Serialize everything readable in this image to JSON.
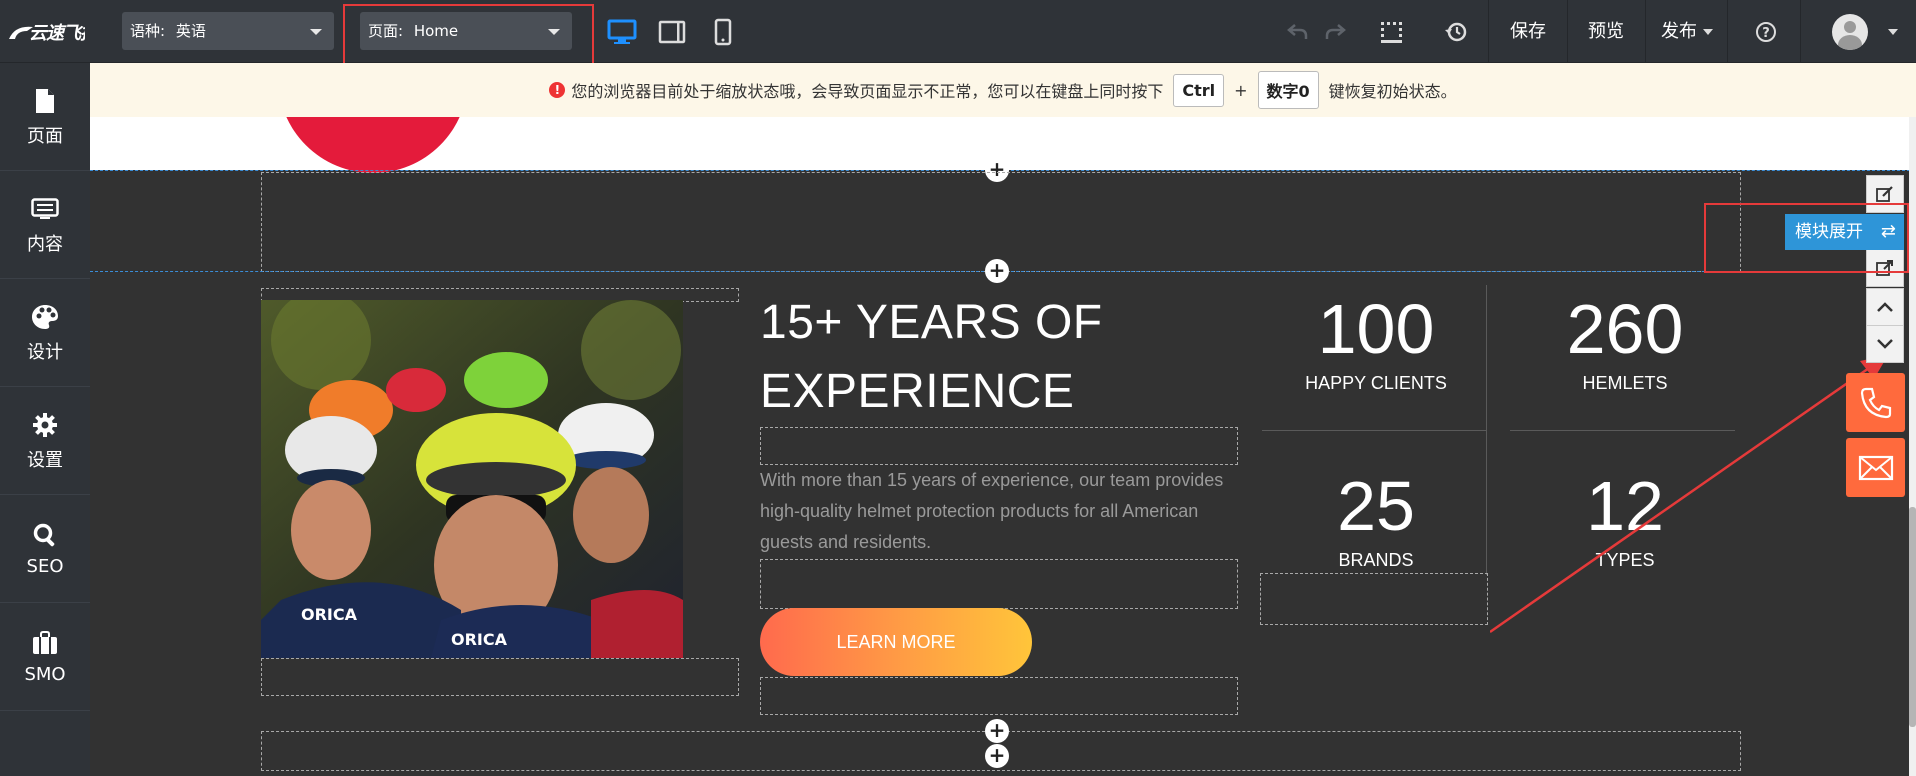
{
  "topbar": {
    "logo_text": "云速飞扬",
    "language_select": {
      "label": "语种:",
      "value": "英语"
    },
    "page_select": {
      "label": "页面:",
      "value": "Home"
    },
    "save_label": "保存",
    "preview_label": "预览",
    "publish_label": "发布"
  },
  "sidebar": {
    "items": [
      {
        "label": "页面",
        "icon": "file-icon"
      },
      {
        "label": "内容",
        "icon": "list-icon"
      },
      {
        "label": "设计",
        "icon": "palette-icon"
      },
      {
        "label": "设置",
        "icon": "gear-icon"
      },
      {
        "label": "SEO",
        "icon": "search-icon"
      },
      {
        "label": "SMO",
        "icon": "briefcase-icon"
      }
    ]
  },
  "notice": {
    "text_before": "您的浏览器目前处于缩放状态哦，会导致页面显示不正常，您可以在键盘上同时按下",
    "key1": "Ctrl",
    "plus": "+",
    "key2": "数字0",
    "text_after": "键恢复初始状态。"
  },
  "content": {
    "heading_line1": "15+ YEARS OF",
    "heading_line2": "EXPERIENCE",
    "description": "With more than 15 years of experience, our team provides high-quality helmet protection products for all American guests and residents.",
    "button_label": "LEARN MORE",
    "stats": [
      {
        "number": "100",
        "label": "HAPPY CLIENTS"
      },
      {
        "number": "260",
        "label": "HEMLETS"
      },
      {
        "number": "25",
        "label": "BRANDS"
      },
      {
        "number": "12",
        "label": "TYPES"
      }
    ]
  },
  "module_tools": {
    "expand_label": "模块展开",
    "expand_icon": "⇄"
  },
  "colors": {
    "accent_blue": "#1e90ff",
    "highlight_red": "#e53a3a",
    "contact_orange": "#ff6a3d",
    "button_gradient_start": "#ff6a4d",
    "button_gradient_end": "#ffc53a"
  }
}
